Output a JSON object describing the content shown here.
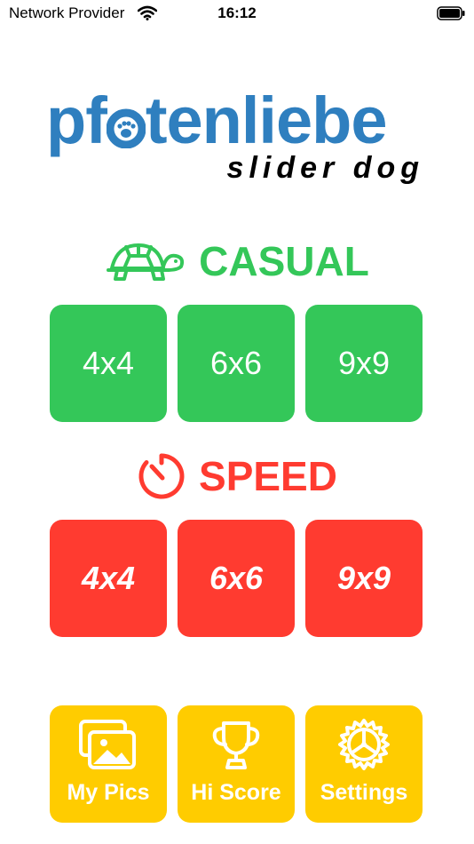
{
  "status_bar": {
    "carrier": "Network Provider",
    "time": "16:12"
  },
  "logo": {
    "title_part1": "pf",
    "title_part2": "tenliebe",
    "subtitle": "slider dog",
    "brand_color": "#2f7fbf"
  },
  "casual": {
    "title": "CASUAL",
    "icon": "turtle-icon",
    "color": "#34c759",
    "tiles": [
      "4x4",
      "6x6",
      "9x9"
    ]
  },
  "speed": {
    "title": "SPEED",
    "icon": "timer-icon",
    "color": "#ff3b30",
    "tiles": [
      "4x4",
      "6x6",
      "9x9"
    ]
  },
  "menu": {
    "color": "#ffcc00",
    "items": [
      {
        "label": "My Pics",
        "icon": "photos-icon"
      },
      {
        "label": "Hi Score",
        "icon": "trophy-icon"
      },
      {
        "label": "Settings",
        "icon": "gear-icon"
      }
    ]
  }
}
